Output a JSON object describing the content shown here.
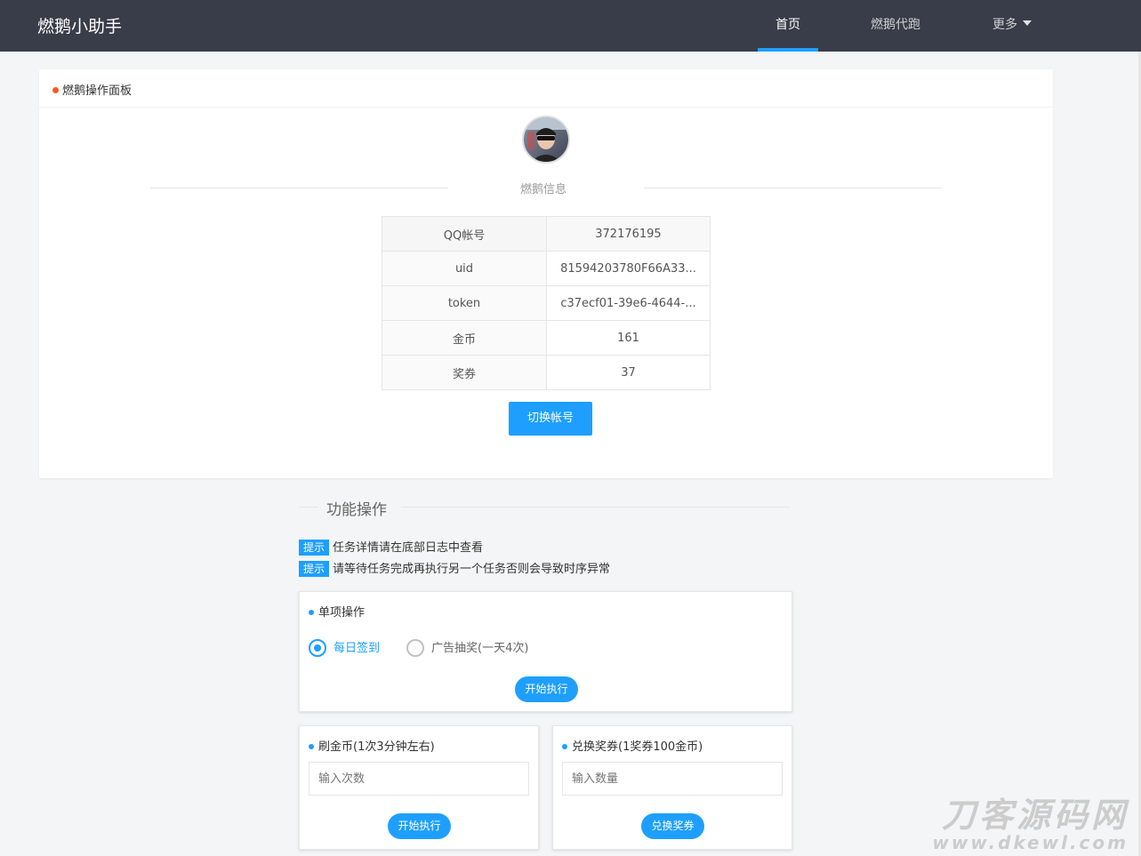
{
  "header": {
    "logo": "燃鹅小助手",
    "nav": [
      {
        "label": "首页",
        "active": true
      },
      {
        "label": "燃鹅代跑",
        "active": false
      },
      {
        "label": "更多",
        "active": false
      }
    ]
  },
  "panel": {
    "title": "燃鹅操作面板",
    "section_label": "燃鹅信息",
    "info": [
      {
        "key": "QQ帐号",
        "value": "372176195"
      },
      {
        "key": "uid",
        "value": "81594203780F66A33..."
      },
      {
        "key": "token",
        "value": "c37ecf01-39e6-4644-..."
      },
      {
        "key": "金币",
        "value": "161"
      },
      {
        "key": "奖券",
        "value": "37"
      }
    ],
    "switch_button": "切换帐号"
  },
  "functions": {
    "title": "功能操作",
    "tips": [
      {
        "badge": "提示",
        "text": "任务详情请在底部日志中查看"
      },
      {
        "badge": "提示",
        "text": "请等待任务完成再执行另一个任务否则会导致时序异常"
      }
    ],
    "single": {
      "title": "单项操作",
      "options": [
        {
          "label": "每日签到",
          "checked": true
        },
        {
          "label": "广告抽奖(一天4次)",
          "checked": false
        }
      ],
      "button": "开始执行"
    },
    "coins": {
      "title": "刷金币(1次3分钟左右)",
      "placeholder": "输入次数",
      "button": "开始执行"
    },
    "exchange": {
      "title": "兑换奖券(1奖券100金币)",
      "placeholder": "输入数量",
      "button": "兑换奖券"
    }
  },
  "watermark": {
    "line1": "刀客源码网",
    "line2": "www.dkewl.com"
  },
  "colors": {
    "header_bg": "#393d49",
    "accent": "#1e9fff",
    "title_dot": "#ff5722"
  }
}
